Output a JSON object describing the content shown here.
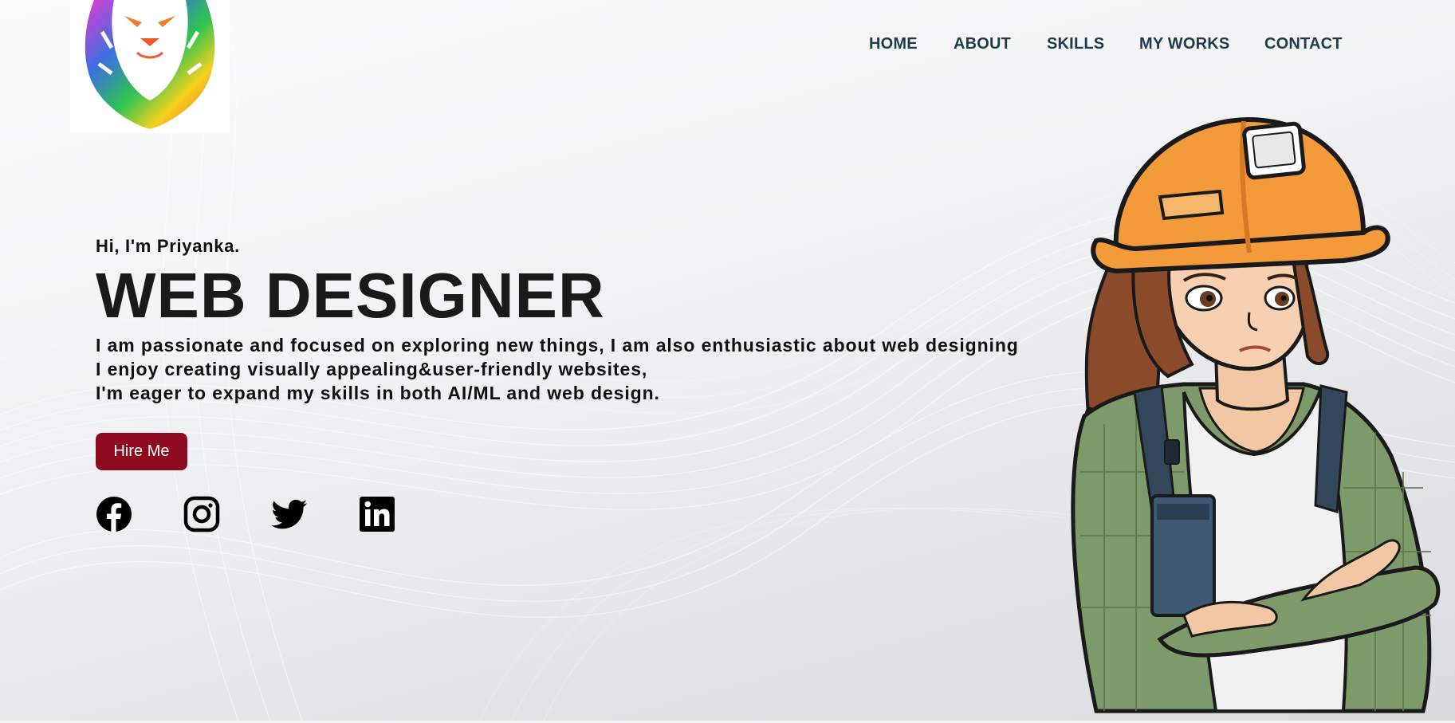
{
  "nav": {
    "items": [
      {
        "label": "HOME"
      },
      {
        "label": "ABOUT"
      },
      {
        "label": "SKILLS"
      },
      {
        "label": "MY WORKS"
      },
      {
        "label": "CONTACT"
      }
    ]
  },
  "hero": {
    "greeting": "Hi, I'm Priyanka.",
    "title": "WEB DESIGNER",
    "description_lines": [
      "I am passionate and focused on exploring new things, I am also enthusiastic about web designing",
      "I enjoy creating visually appealing&user-friendly websites,",
      "I'm eager to expand my skills in both AI/ML and web design."
    ],
    "cta_label": "Hire Me"
  },
  "socials": [
    {
      "icon": "facebook-icon"
    },
    {
      "icon": "instagram-icon"
    },
    {
      "icon": "twitter-icon"
    },
    {
      "icon": "linkedin-icon"
    }
  ],
  "illustration": {
    "subject": "cartoon woman wearing an orange hard hat and green plaid shirt with arms crossed"
  },
  "colors": {
    "nav_text": "#1f3b4a",
    "button_bg": "#8d0a1f",
    "button_text": "#ffffff",
    "heading_text": "#1a1a1a",
    "hard_hat": "#f39a3a",
    "shirt": "#7f9a6a"
  }
}
